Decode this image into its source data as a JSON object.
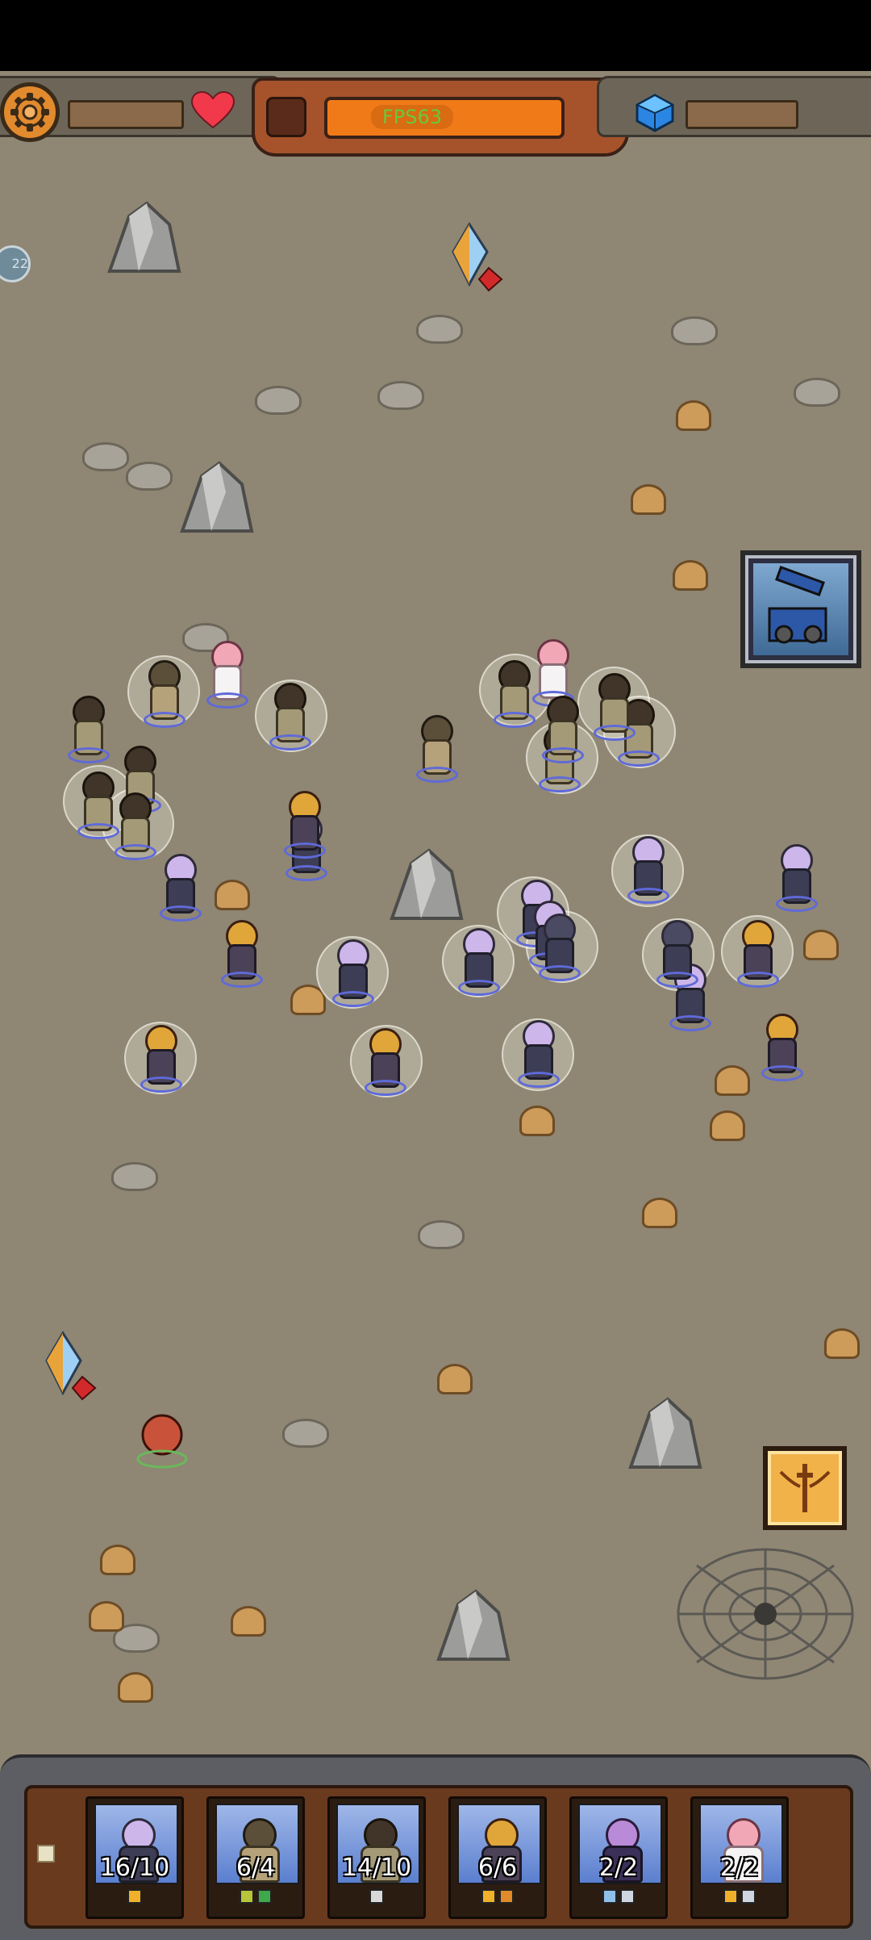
{
  "hud": {
    "fps_text": "FPS63",
    "side_counter": "22"
  },
  "colors": {
    "ground": "#8f8674",
    "hud_orange": "#f07a18",
    "fps_text_color": "#69c83a",
    "team_ring": "#5f6ad8"
  },
  "icons": {
    "settings": "gear-icon",
    "health": "heart-icon",
    "currency": "blue-crystal-icon",
    "hero_card": "mech-card-icon",
    "skill_card": "winged-sword-icon"
  },
  "army_bar": {
    "slots": [
      {
        "unit": "ninja",
        "count": "16/10"
      },
      {
        "unit": "monk",
        "count": "6/4"
      },
      {
        "unit": "archer",
        "count": "14/10"
      },
      {
        "unit": "spartan",
        "count": "6/6"
      },
      {
        "unit": "sorcerer",
        "count": "2/2"
      },
      {
        "unit": "nurse",
        "count": "2/2"
      }
    ]
  }
}
